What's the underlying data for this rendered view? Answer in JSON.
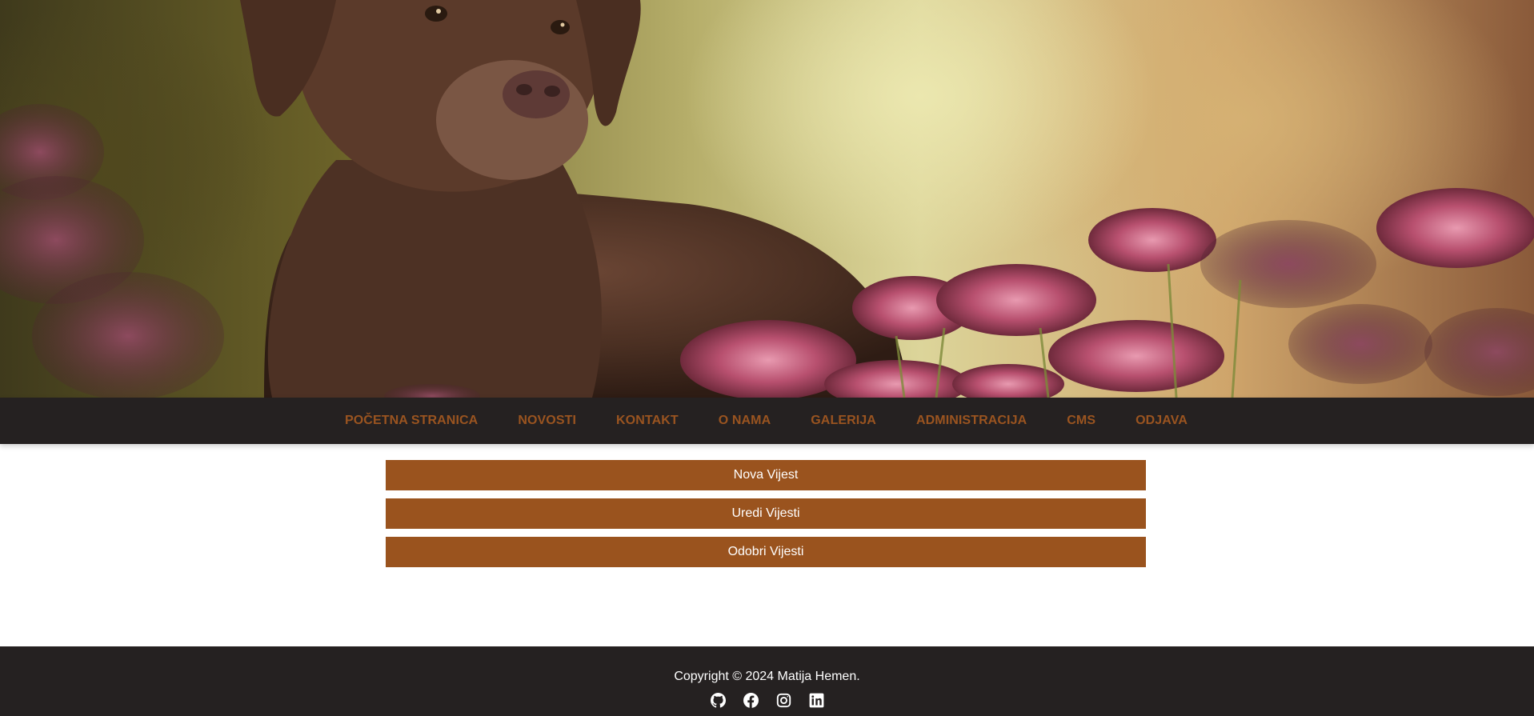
{
  "hero": {
    "image": "labrador-dog-with-pink-flowers-photo"
  },
  "nav": {
    "items": [
      {
        "label": "POČETNA STRANICA"
      },
      {
        "label": "NOVOSTI"
      },
      {
        "label": "KONTAKT"
      },
      {
        "label": "O NAMA"
      },
      {
        "label": "GALERIJA"
      },
      {
        "label": "ADMINISTRACIJA"
      },
      {
        "label": "CMS"
      },
      {
        "label": "ODJAVA"
      }
    ]
  },
  "admin": {
    "buttons": [
      {
        "label": "Nova Vijest"
      },
      {
        "label": "Uredi Vijesti"
      },
      {
        "label": "Odobri Vijesti"
      }
    ]
  },
  "footer": {
    "copyright": "Copyright © 2024 Matija Hemen.",
    "socials": [
      {
        "icon": "github-icon"
      },
      {
        "icon": "facebook-icon"
      },
      {
        "icon": "instagram-icon"
      },
      {
        "icon": "linkedin-icon"
      }
    ]
  },
  "colors": {
    "accent": "#9a531e",
    "nav_text": "#9a5420",
    "dark_bar": "#252121",
    "button_text": "#ffffff"
  }
}
